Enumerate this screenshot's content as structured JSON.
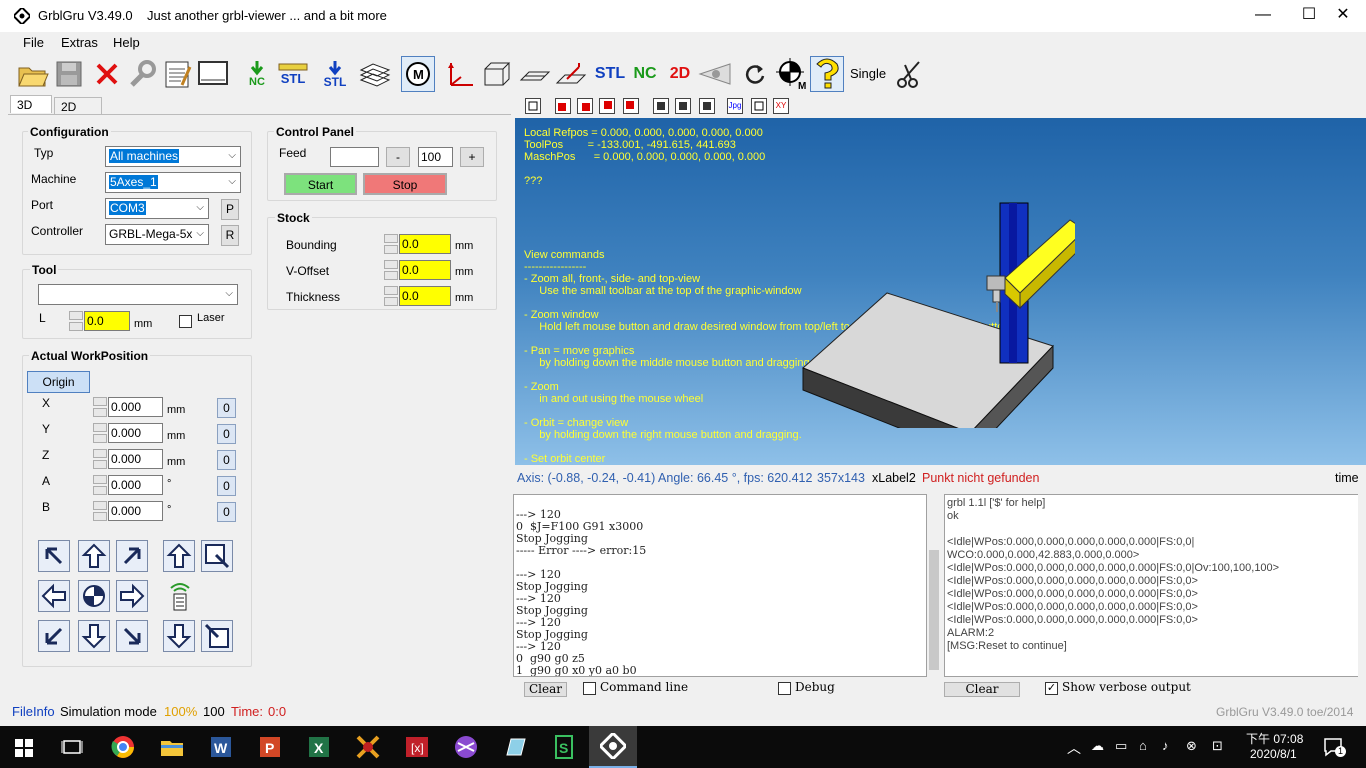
{
  "window": {
    "title": "GrblGru V3.49.0",
    "subtitle": "Just another grbl-viewer ... and a bit more",
    "controls": {
      "minimize": "—",
      "maximize": "☐",
      "close": "✕"
    }
  },
  "menu": [
    "File",
    "Extras",
    "Help"
  ],
  "toolbar": {
    "nc_label": "NC",
    "stl_label": "STL",
    "stl_label2": "STL",
    "stl_text": "STL",
    "nc_text": "NC",
    "twod_text": "2D",
    "single_label": "Single",
    "colors": {
      "nc": "#1a9a1a",
      "stl": "#1040c0",
      "twod": "#e01010",
      "close": "#e01010"
    }
  },
  "tabs": {
    "left": [
      "3D",
      "2D"
    ]
  },
  "configuration": {
    "title": "Configuration",
    "typ_label": "Typ",
    "typ_value": "All machines",
    "machine_label": "Machine",
    "machine_value": "5Axes_1",
    "port_label": "Port",
    "port_value": "COM3",
    "port_btn": "P",
    "controller_label": "Controller",
    "controller_value": "GRBL-Mega-5x",
    "controller_btn": "R"
  },
  "control_panel": {
    "title": "Control Panel",
    "feed_label": "Feed",
    "feed_value": "",
    "minus": "-",
    "percent": "100",
    "plus": "+",
    "start": "Start",
    "stop": "Stop"
  },
  "stock": {
    "title": "Stock",
    "rows": [
      {
        "label": "Bounding",
        "value": "0.0",
        "unit": "mm"
      },
      {
        "label": "V-Offset",
        "value": "0.0",
        "unit": "mm"
      },
      {
        "label": "Thickness",
        "value": "0.0",
        "unit": "mm"
      }
    ]
  },
  "tool": {
    "title": "Tool",
    "select_value": "",
    "l_label": "L",
    "l_value": "0.0",
    "l_unit": "mm",
    "laser_label": "Laser"
  },
  "workposition": {
    "title": "Actual WorkPosition",
    "origin": "Origin",
    "axes": [
      {
        "label": "X",
        "value": "0.000",
        "unit": "mm",
        "zero": "0"
      },
      {
        "label": "Y",
        "value": "0.000",
        "unit": "mm",
        "zero": "0"
      },
      {
        "label": "Z",
        "value": "0.000",
        "unit": "mm",
        "zero": "0"
      },
      {
        "label": "A",
        "value": "0.000",
        "unit": "°",
        "zero": "0"
      },
      {
        "label": "B",
        "value": "0.000",
        "unit": "°",
        "zero": "0"
      }
    ]
  },
  "graphics": {
    "toolbar_labels": {
      "jpg": "Jpg",
      "xy": "XY"
    },
    "info": {
      "local_refpos": "Local Refpos = 0.000, 0.000, 0.000, 0.000, 0.000",
      "toolpos": "ToolPos        = -133.001, -491.615, 441.693",
      "maschpos": "MaschPos      = 0.000, 0.000, 0.000, 0.000, 0.000",
      "unknown": "???"
    },
    "help": [
      "View commands",
      "-----------------",
      "- Zoom all, front-, side- and top-view",
      "     Use the small toolbar at the top of the graphic-window",
      "",
      "- Zoom window",
      "     Hold left mouse button and draw desired window from top/left to bottom/right. Release the button.",
      "",
      "- Pan = move graphics",
      "     by holding down the middle mouse button and dragging.",
      "",
      "- Zoom",
      "     in and out using the mouse wheel",
      "",
      "- Orbit = change view",
      "     by holding down the right mouse button and dragging.",
      "",
      "- Set orbit center"
    ]
  },
  "status3d": {
    "axis": "Axis: (-0.88, -0.24, -0.41) Angle: 66.45 °, fps: 620.412",
    "size": "357x143",
    "xlabel": "xLabel2",
    "error": "Punkt nicht gefunden",
    "time": "time"
  },
  "console_left": {
    "lines": [
      "",
      "---> 120",
      "0  $J=F100 G91 x3000",
      "Stop Jogging",
      "----- Error ----> error:15",
      "",
      "---> 120",
      "Stop Jogging",
      "---> 120",
      "Stop Jogging",
      "---> 120",
      "Stop Jogging",
      "---> 120",
      "0  g90 g0 z5",
      "1  g90 g0 x0 y0 a0 b0"
    ],
    "clear": "Clear",
    "cmdline_label": "Command line",
    "debug_label": "Debug"
  },
  "console_right": {
    "lines": [
      "grbl 1.1l ['$' for help]",
      "ok",
      "",
      "<Idle|WPos:0.000,0.000,0.000,0.000,0.000|FS:0,0|",
      "WCO:0.000,0.000,42.883,0.000,0.000>",
      "<Idle|WPos:0.000,0.000,0.000,0.000,0.000|FS:0,0|Ov:100,100,100>",
      "<Idle|WPos:0.000,0.000,0.000,0.000,0.000|FS:0,0>",
      "<Idle|WPos:0.000,0.000,0.000,0.000,0.000|FS:0,0>",
      "<Idle|WPos:0.000,0.000,0.000,0.000,0.000|FS:0,0>",
      "<Idle|WPos:0.000,0.000,0.000,0.000,0.000|FS:0,0>",
      "ALARM:2",
      "[MSG:Reset to continue]"
    ],
    "clear": "Clear",
    "verbose_label": "Show verbose output"
  },
  "statusbar": {
    "fileinfo": "FileInfo",
    "mode": "Simulation mode",
    "percent": "100%",
    "feed": "100",
    "time_label": "Time:",
    "time_value": "0:0",
    "version": "GrblGru V3.49.0 toe/2014"
  },
  "taskbar": {
    "time": "下午 07:08",
    "date": "2020/8/1",
    "notif_count": "1"
  }
}
